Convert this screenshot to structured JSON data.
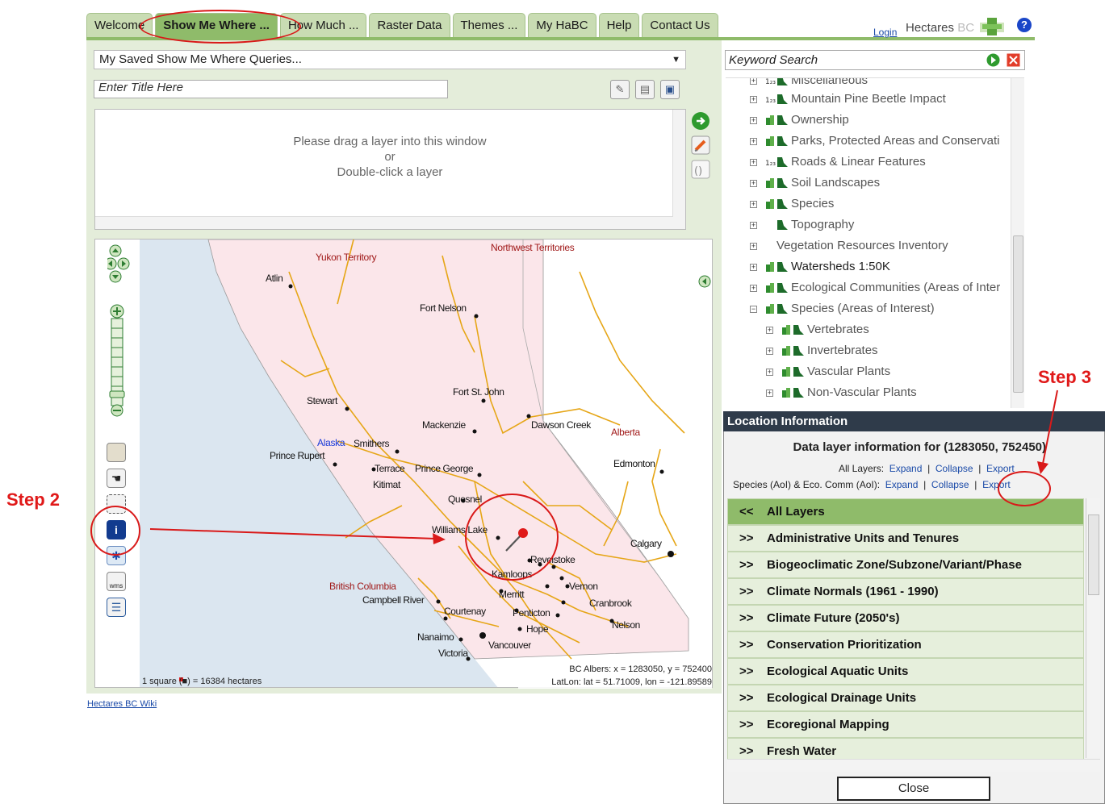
{
  "tabs": [
    "Welcome",
    "Show Me Where ...",
    "How Much ...",
    "Raster Data",
    "Themes ...",
    "My HaBC",
    "Help",
    "Contact Us"
  ],
  "active_tab": "Show Me Where ...",
  "header": {
    "login": "Login",
    "brand": "Hectares",
    "brand_suffix": "BC",
    "help_icon": "?"
  },
  "query": {
    "saved_queries": "My Saved Show Me Where Queries...",
    "title_placeholder": "Enter Title Here",
    "drop_line1": "Please drag a layer into this window",
    "drop_line2": "or",
    "drop_line3": "Double-click a layer"
  },
  "map": {
    "cities": [
      "Atlin",
      "Fort Nelson",
      "Stewart",
      "Fort St. John",
      "Mackenzie",
      "Dawson Creek",
      "Smithers",
      "Prince Rupert",
      "Terrace",
      "Prince George",
      "Kitimat",
      "Quesnel",
      "Williams Lake",
      "Edmonton",
      "Calgary",
      "Revelstoke",
      "Kamloops",
      "Vernon",
      "Merritt",
      "Campbell River",
      "Courtenay",
      "Penticton",
      "Cranbrook",
      "Hope",
      "Nelson",
      "Nanaimo",
      "Vancouver",
      "Victoria"
    ],
    "regions": [
      "Yukon Territory",
      "Northwest Territories",
      "Alaska",
      "Alberta",
      "British Columbia"
    ],
    "scale": "1 square (■) = 16384 hectares",
    "coords_albers": "BC Albers: x = 1283050, y = 752400",
    "coords_latlon": "LatLon: lat = 51.71009, lon = -121.89589"
  },
  "wiki_link": "Hectares BC Wiki",
  "keyword_search": "Keyword Search",
  "layers": [
    {
      "label": "Miscellaneous",
      "kind": "num"
    },
    {
      "label": "Mountain Pine Beetle Impact",
      "kind": "num"
    },
    {
      "label": "Ownership",
      "kind": "std"
    },
    {
      "label": "Parks, Protected Areas and Conservati",
      "kind": "std"
    },
    {
      "label": "Roads & Linear Features",
      "kind": "num"
    },
    {
      "label": "Soil Landscapes",
      "kind": "std"
    },
    {
      "label": "Species",
      "kind": "std"
    },
    {
      "label": "Topography",
      "kind": "one"
    },
    {
      "label": "Vegetation Resources Inventory",
      "kind": "none"
    },
    {
      "label": "Watersheds 1:50K",
      "kind": "std"
    },
    {
      "label": "Ecological Communities (Areas of Inter",
      "kind": "std"
    },
    {
      "label": "Species (Areas of Interest)",
      "kind": "std"
    },
    {
      "label": "Vertebrates",
      "kind": "std"
    },
    {
      "label": "Invertebrates",
      "kind": "std"
    },
    {
      "label": "Vascular Plants",
      "kind": "std"
    },
    {
      "label": "Non-Vascular Plants",
      "kind": "std"
    }
  ],
  "location": {
    "title": "Location Information",
    "data_info": "Data layer information for (1283050, 752450)",
    "all_layers_label": "All Layers:",
    "species_label": "Species (AoI) & Eco. Comm (AoI):",
    "expand": "Expand",
    "collapse": "Collapse",
    "export": "Export",
    "sep": "|",
    "categories": [
      "All Layers",
      "Administrative Units and Tenures",
      "Biogeoclimatic Zone/Subzone/Variant/Phase",
      "Climate Normals (1961 - 1990)",
      "Climate Future (2050's)",
      "Conservation Prioritization",
      "Ecological Aquatic Units",
      "Ecological Drainage Units",
      "Ecoregional Mapping",
      "Fresh Water"
    ],
    "collapse_prefix": "<<",
    "expand_prefix": ">>",
    "close": "Close"
  },
  "annotations": {
    "step2": "Step 2",
    "step3": "Step 3"
  },
  "colors": {
    "tab_active": "#8fbb6a",
    "tab": "#c9dcb3",
    "panel": "#e4edda",
    "annot": "#e01919",
    "header_dark": "#2f3b4a",
    "link": "#1a4aa8"
  }
}
